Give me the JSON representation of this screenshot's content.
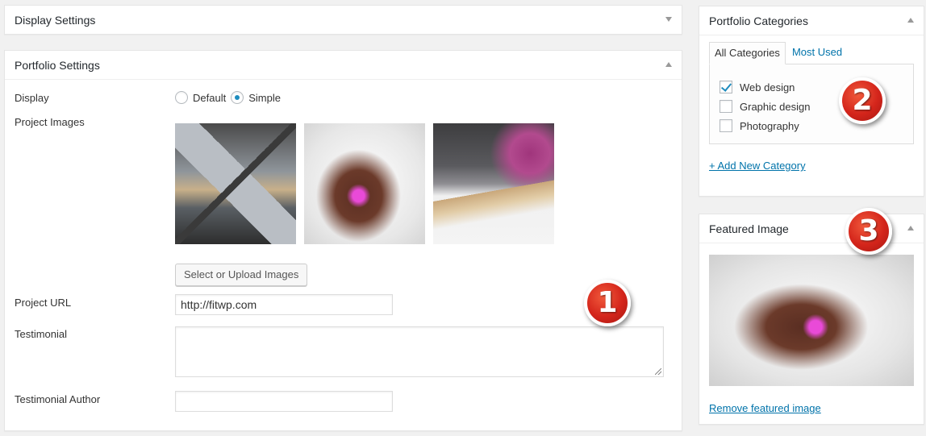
{
  "display_settings": {
    "title": "Display Settings"
  },
  "portfolio_settings": {
    "title": "Portfolio Settings",
    "display_label": "Display",
    "display_options": [
      "Default",
      "Simple"
    ],
    "display_selected": "Simple",
    "project_images_label": "Project Images",
    "select_button": "Select or Upload Images",
    "project_url_label": "Project URL",
    "project_url_value": "http://fitwp.com",
    "testimonial_label": "Testimonial",
    "testimonial_value": "",
    "testimonial_author_label": "Testimonial Author",
    "testimonial_author_value": ""
  },
  "portfolio_categories": {
    "title": "Portfolio Categories",
    "tabs": [
      "All Categories",
      "Most Used"
    ],
    "active_tab": "All Categories",
    "items": [
      {
        "label": "Web design",
        "checked": true
      },
      {
        "label": "Graphic design",
        "checked": false
      },
      {
        "label": "Photography",
        "checked": false
      }
    ],
    "add_link": "+ Add New Category"
  },
  "featured_image": {
    "title": "Featured Image",
    "remove_link": "Remove featured image"
  },
  "badges": [
    "1",
    "2",
    "3"
  ],
  "colors": {
    "link": "#0073aa",
    "accent": "#1e8cbe",
    "badge": "#d4251b"
  }
}
